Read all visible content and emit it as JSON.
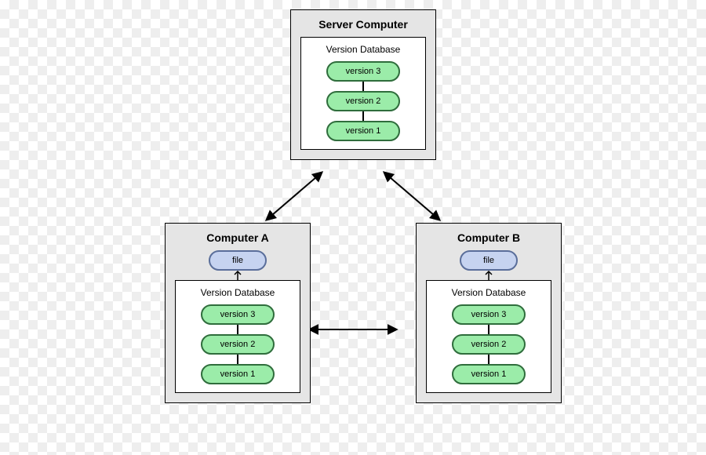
{
  "server": {
    "title": "Server Computer",
    "db_label": "Version Database",
    "versions": [
      "version 3",
      "version 2",
      "version 1"
    ]
  },
  "computer_a": {
    "title": "Computer A",
    "file_label": "file",
    "db_label": "Version Database",
    "versions": [
      "version 3",
      "version 2",
      "version 1"
    ]
  },
  "computer_b": {
    "title": "Computer B",
    "file_label": "file",
    "db_label": "Version Database",
    "versions": [
      "version 3",
      "version 2",
      "version 1"
    ]
  },
  "colors": {
    "green_fill": "#9beca9",
    "green_border": "#2f6d3c",
    "blue_fill": "#c6d3f0",
    "blue_border": "#5a6e9a",
    "box_fill": "#e5e5e5"
  }
}
